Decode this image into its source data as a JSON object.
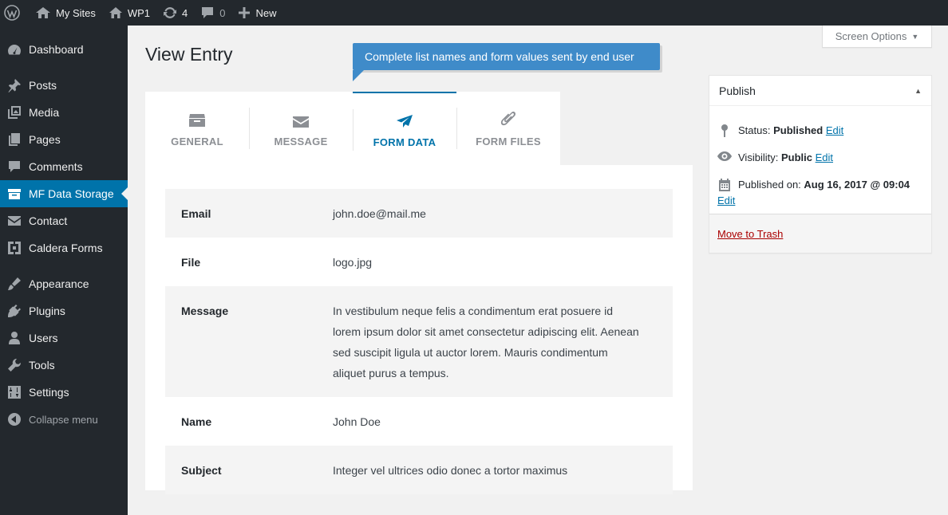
{
  "adminbar": {
    "my_sites": "My Sites",
    "site_name": "WP1",
    "updates_count": "4",
    "comments_count": "0",
    "new_label": "New"
  },
  "sidebar": {
    "items": [
      {
        "label": "Dashboard",
        "icon": "dashboard-icon"
      },
      {
        "label": "Posts",
        "icon": "pin-icon"
      },
      {
        "label": "Media",
        "icon": "media-icon"
      },
      {
        "label": "Pages",
        "icon": "pages-icon"
      },
      {
        "label": "Comments",
        "icon": "comment-icon"
      },
      {
        "label": "MF Data Storage",
        "icon": "archive-icon",
        "current": true
      },
      {
        "label": "Contact",
        "icon": "mail-icon"
      },
      {
        "label": "Caldera Forms",
        "icon": "caldera-icon"
      },
      {
        "label": "Appearance",
        "icon": "brush-icon"
      },
      {
        "label": "Plugins",
        "icon": "plugin-icon"
      },
      {
        "label": "Users",
        "icon": "users-icon"
      },
      {
        "label": "Tools",
        "icon": "wrench-icon"
      },
      {
        "label": "Settings",
        "icon": "settings-icon"
      }
    ],
    "collapse_label": "Collapse menu"
  },
  "screen_options": "Screen Options",
  "page_title": "View Entry",
  "pointer_text": "Complete list names and form values sent by end user",
  "tabs": [
    {
      "label": "GENERAL",
      "icon": "archive-icon"
    },
    {
      "label": "MESSAGE",
      "icon": "envelope-icon"
    },
    {
      "label": "FORM DATA",
      "icon": "paper-plane-icon",
      "active": true
    },
    {
      "label": "FORM FILES",
      "icon": "paperclip-icon"
    }
  ],
  "fields": [
    {
      "label": "Email",
      "value": "john.doe@mail.me"
    },
    {
      "label": "File",
      "value": "logo.jpg"
    },
    {
      "label": "Message",
      "value": "In vestibulum neque felis a condimentum erat posuere id lorem ipsum dolor sit amet consectetur adipiscing elit. Aenean sed suscipit ligula ut auctor lorem. Mauris condimentum aliquet purus a tempus."
    },
    {
      "label": "Name",
      "value": "John Doe"
    },
    {
      "label": "Subject",
      "value": "Integer vel ultrices odio donec a tortor maximus"
    }
  ],
  "publish": {
    "title": "Publish",
    "status_label": "Status:",
    "status_value": "Published",
    "visibility_label": "Visibility:",
    "visibility_value": "Public",
    "published_label": "Published on:",
    "published_value": "Aug 16, 2017 @ 09:04",
    "edit_label": "Edit",
    "trash_label": "Move to Trash"
  },
  "colors": {
    "admin_dark": "#23282d",
    "accent": "#0073aa",
    "pointer_blue": "#3f8bc9",
    "trash_red": "#aa0000"
  }
}
